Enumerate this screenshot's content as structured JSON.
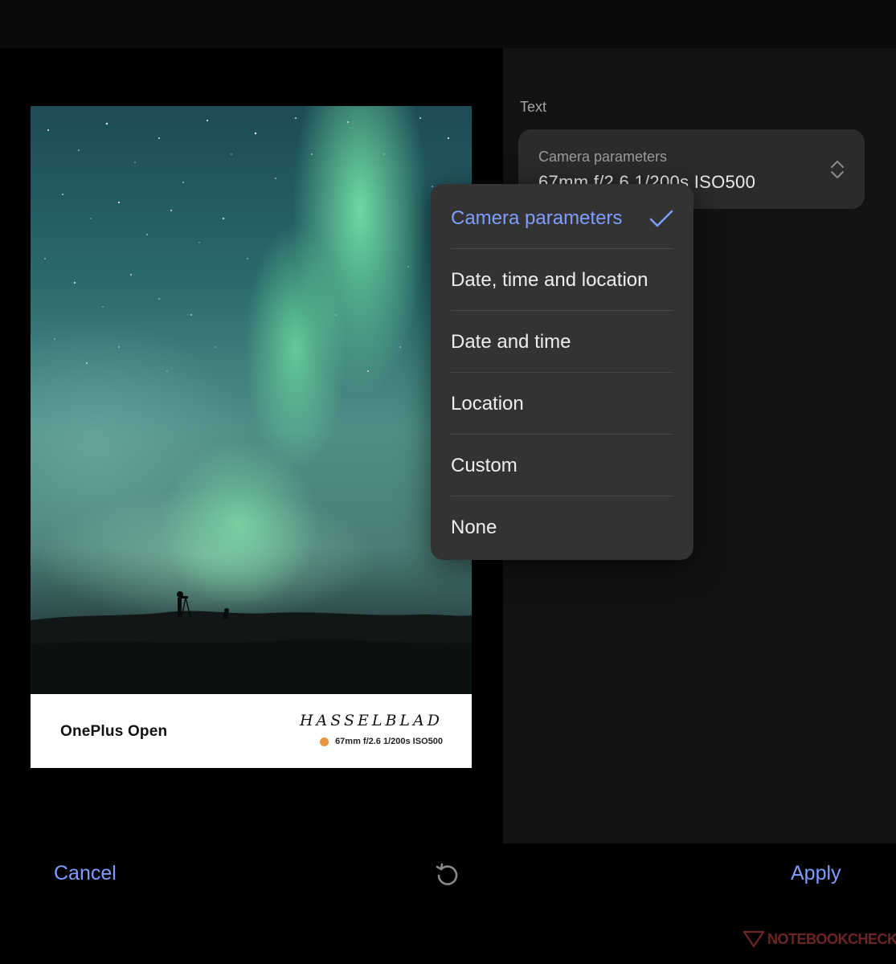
{
  "preview": {
    "watermark": {
      "model": "OnePlus Open",
      "brand": "HASSELBLAD",
      "params": "67mm  f/2.6  1/200s  ISO500",
      "dot_color": "#e69642"
    }
  },
  "settings": {
    "section_label": "Text",
    "select": {
      "title": "Camera parameters",
      "value": "67mm  f/2.6  1/200s  ISO500"
    }
  },
  "dropdown": {
    "items": [
      {
        "label": "Camera parameters",
        "selected": true
      },
      {
        "label": "Date, time and location",
        "selected": false
      },
      {
        "label": "Date and time",
        "selected": false
      },
      {
        "label": "Location",
        "selected": false
      },
      {
        "label": "Custom",
        "selected": false
      },
      {
        "label": "None",
        "selected": false
      }
    ]
  },
  "bottom": {
    "cancel_label": "Cancel",
    "apply_label": "Apply",
    "reset_icon": "reset-icon"
  },
  "overlay_logo": "NOTEBOOKCHECK",
  "colors": {
    "accent": "#7f9dff",
    "panel": "#2b2b2b",
    "dropdown": "#333333"
  }
}
